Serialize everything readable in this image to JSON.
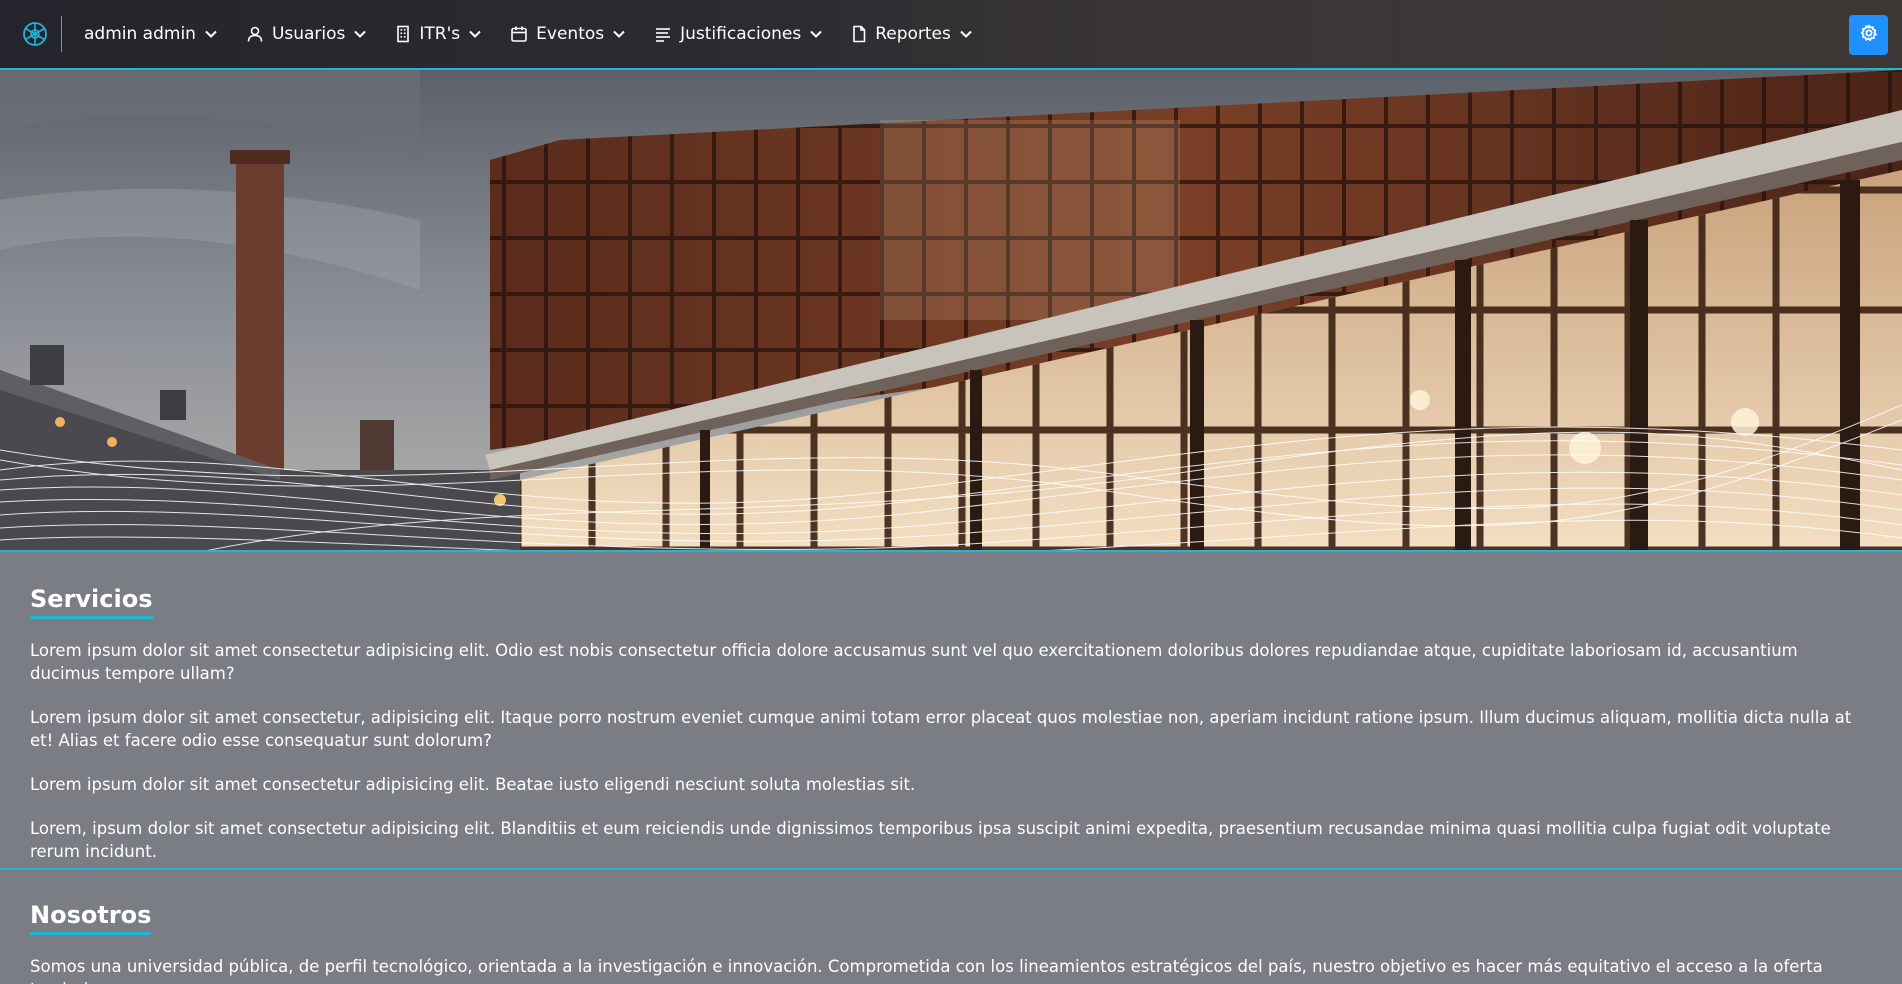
{
  "nav": {
    "user": "admin admin",
    "items": [
      {
        "label": "Usuarios",
        "icon": "user-icon"
      },
      {
        "label": "ITR's",
        "icon": "building-icon"
      },
      {
        "label": "Eventos",
        "icon": "calendar-icon"
      },
      {
        "label": "Justificaciones",
        "icon": "list-icon"
      },
      {
        "label": "Reportes",
        "icon": "file-icon"
      }
    ]
  },
  "colors": {
    "accent": "#1fb6d8",
    "settings_button": "#1e90ff",
    "page_bg": "#7a7d83"
  },
  "servicios": {
    "title": "Servicios",
    "paragraphs": [
      "Lorem ipsum dolor sit amet consectetur adipisicing elit. Odio est nobis consectetur officia dolore accusamus sunt vel quo exercitationem doloribus dolores repudiandae atque, cupiditate laboriosam id, accusantium ducimus tempore ullam?",
      "Lorem ipsum dolor sit amet consectetur, adipisicing elit. Itaque porro nostrum eveniet cumque animi totam error placeat quos molestiae non, aperiam incidunt ratione ipsum. Illum ducimus aliquam, mollitia dicta nulla at et! Alias et facere odio esse consequatur sunt dolorum?",
      "Lorem ipsum dolor sit amet consectetur adipisicing elit. Beatae iusto eligendi nesciunt soluta molestias sit.",
      "Lorem, ipsum dolor sit amet consectetur adipisicing elit. Blanditiis et eum reiciendis unde dignissimos temporibus ipsa suscipit animi expedita, praesentium recusandae minima quasi mollitia culpa fugiat odit voluptate rerum incidunt."
    ]
  },
  "nosotros": {
    "title": "Nosotros",
    "paragraphs": [
      "Somos una universidad pública, de perfil tecnológico, orientada a la investigación e innovación. Comprometida con los lineamientos estratégicos del país, nuestro objetivo es hacer más equitativo el acceso a la oferta terciaria"
    ]
  }
}
